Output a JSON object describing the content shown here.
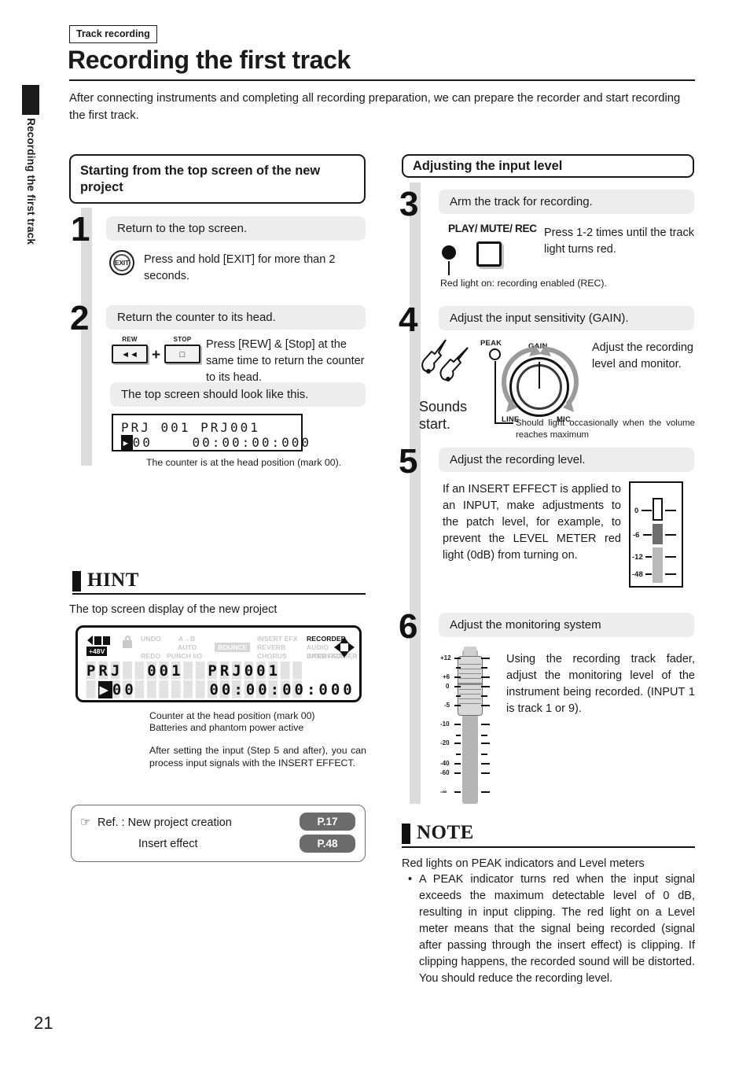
{
  "sidebar": {
    "tab_label": "Recording the first track"
  },
  "header": {
    "kicker": "Track recording",
    "title": "Recording the first track",
    "intro": "After connecting instruments and completing all recording preparation, we can prepare the recorder and start recording the first track."
  },
  "left_section": {
    "heading": "Starting from the top screen of the new project",
    "steps": [
      {
        "number": "1",
        "tagline": "Return to the top screen.",
        "icon_label": "EXIT",
        "instruction": "Press and hold [EXIT] for more than 2 seconds."
      },
      {
        "number": "2",
        "tagline": "Return the counter to its head.",
        "btn1_caption": "REW",
        "btn1_glyph": "◄◄",
        "plus": "+",
        "btn2_caption": "STOP",
        "btn2_glyph": "□",
        "instruction": "Press [REW] & [Stop] at the same time to return the counter to its head.",
        "tagline2": "The top screen should look like this.",
        "lcd_line1": "PRJ 001 PRJ001",
        "lcd_mark": "▸",
        "lcd_line2_mark": "00",
        "lcd_line2_time": "00:00:00:000",
        "lcd_caption": "The counter is at the head position (mark 00)."
      }
    ]
  },
  "hint": {
    "title": "HINT",
    "subtitle": "The top screen display of the new project",
    "display": {
      "battery_label": "+48V",
      "indicators_col1": [
        "UNDO",
        "REDO"
      ],
      "indicators_col2": [
        "A↔B",
        "AUTO",
        "PUNCH I/O"
      ],
      "bounce": "BOUNCE",
      "indicators_col3": [
        "INSERT EFX",
        "REVERB",
        "CHORUS"
      ],
      "indicators_col4": [
        "RECORDER",
        "AUDIO INTERFACE",
        "CARD READER"
      ],
      "active_indicator": "RECORDER",
      "line1": "PRJ  001  PRJ001",
      "line2_mark": "00",
      "line2_time": "00:00:00:000"
    },
    "caption1": "Counter at the head position (mark 00)",
    "caption2": "Batteries and phantom power active",
    "caption3": "After setting the input (Step 5 and after), you can process input signals with the INSERT EFFECT."
  },
  "ref_box": {
    "icon": "pointing-hand",
    "row1_label": "Ref. : New project creation",
    "row1_page": "P.17",
    "row2_label": "Insert effect",
    "row2_page": "P.48"
  },
  "right_section": {
    "heading": "Adjusting the input level",
    "steps": [
      {
        "number": "3",
        "tagline": "Arm the track for recording.",
        "button_label": "PLAY/ MUTE/ REC",
        "instruction": "Press 1-2 times until the track light turns red.",
        "caption": "Red light on: recording enabled (REC)."
      },
      {
        "number": "4",
        "tagline": "Adjust the input sensitivity (GAIN).",
        "sounds_text": "Sounds start.",
        "peak_label": "PEAK",
        "knob_top": "GAIN",
        "knob_left": "LINE",
        "knob_right": "MIC",
        "instruction": "Adjust the recording level and monitor.",
        "caption": "Should light occasionally when the volume reaches maximum"
      },
      {
        "number": "5",
        "tagline": "Adjust the recording level.",
        "instruction": "If an INSERT EFFECT is applied to an INPUT, make adjustments to the patch level, for example, to prevent the LEVEL METER red light (0dB) from turning on.",
        "meter_labels": [
          "0",
          "-6",
          "-12",
          "-48"
        ]
      },
      {
        "number": "6",
        "tagline": "Adjust the monitoring system",
        "instruction": "Using the recording track fader, adjust the monitoring level of the instrument being recorded. (INPUT 1 is track 1 or 9).",
        "fader_labels": [
          "+12",
          "+6",
          "0",
          "-5",
          "-10",
          "-20",
          "-40",
          "-60",
          "-∞"
        ]
      }
    ]
  },
  "note": {
    "title": "NOTE",
    "lead": "Red lights on  PEAK indicators and Level meters",
    "bullet": "•",
    "body": "A PEAK indicator turns red when the input signal exceeds the maximum detectable level of 0 dB, resulting in input clipping. The red light on a Level meter means that the signal being recorded (signal after passing through the insert effect) is clipping. If clipping happens, the recorded sound will be distorted. You should reduce the recording level."
  },
  "footer": {
    "page_number": "21"
  }
}
